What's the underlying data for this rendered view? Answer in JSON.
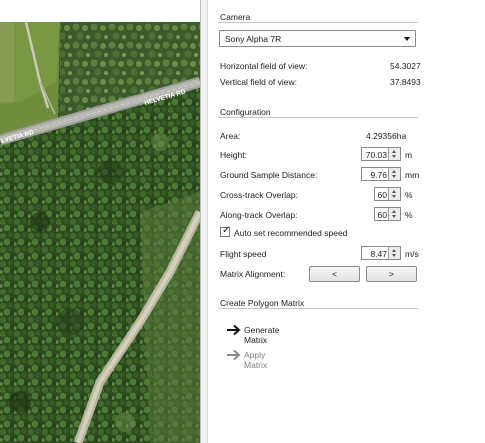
{
  "map": {
    "road_labels": [
      "HELVETIA RD",
      "LVETIA RD"
    ]
  },
  "camera": {
    "section_title": "Camera",
    "selected_camera": "Sony Alpha 7R",
    "hfov_label": "Horizontal field of view:",
    "hfov_value": "54.3027",
    "vfov_label": "Vertical field of view:",
    "vfov_value": "37.8493"
  },
  "configuration": {
    "section_title": "Configuration",
    "area_label": "Area:",
    "area_value": "4.29356ha",
    "height_label": "Height:",
    "height_value": "70.03",
    "height_unit": "m",
    "gsd_label": "Ground Sample Distance:",
    "gsd_value": "9.76",
    "gsd_unit": "mm",
    "cross_label": "Cross-track Overlap:",
    "cross_value": "60",
    "cross_unit": "%",
    "along_label": "Along-track Overlap:",
    "along_value": "60",
    "along_unit": "%",
    "auto_speed_label": "Auto set recommended speed",
    "auto_speed_checked": true,
    "speed_label": "Flight speed",
    "speed_value": "8.47",
    "speed_unit": "m/s",
    "alignment_label": "Matrix Alignment:",
    "align_left_label": "<",
    "align_right_label": ">"
  },
  "polygon": {
    "section_title": "Create Polygon Matrix",
    "generate_label": "Generate Matrix",
    "apply_label": "Apply Matrix"
  },
  "colors": {
    "forest": "#2f4a22",
    "road": "#a9aaa4",
    "disabled_text": "#808080"
  }
}
